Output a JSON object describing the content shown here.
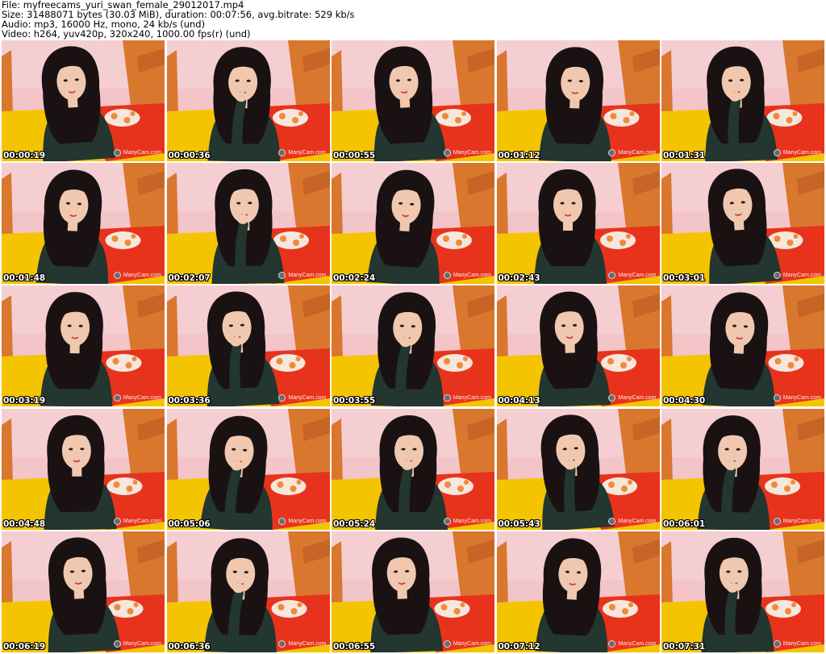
{
  "header": {
    "file_line": "File: myfreecams_yuri_swan_female_29012017.mp4",
    "size_line": "Size: 31488071 bytes (30.03 MiB), duration: 00:07:56, avg.bitrate: 529 kb/s",
    "audio_line": "Audio: mp3, 16000 Hz, mono, 24 kb/s (und)",
    "video_line": "Video: h264, yuv420p, 320x240, 1000.00 fps(r) (und)"
  },
  "watermark": "ManyCam.com",
  "colors": {
    "wall": "#f3c4c8",
    "wood": "#d9772e",
    "yellow_bedding": "#f5c400",
    "red_bedding": "#e8331c",
    "sweater": "#23362f",
    "hair": "#1a1212",
    "skin": "#f0c8b0"
  },
  "thumbnails": [
    {
      "timestamp": "00:00:19"
    },
    {
      "timestamp": "00:00:36"
    },
    {
      "timestamp": "00:00:55"
    },
    {
      "timestamp": "00:01:12"
    },
    {
      "timestamp": "00:01:31"
    },
    {
      "timestamp": "00:01:48"
    },
    {
      "timestamp": "00:02:07"
    },
    {
      "timestamp": "00:02:24"
    },
    {
      "timestamp": "00:02:43"
    },
    {
      "timestamp": "00:03:01"
    },
    {
      "timestamp": "00:03:19"
    },
    {
      "timestamp": "00:03:36"
    },
    {
      "timestamp": "00:03:55"
    },
    {
      "timestamp": "00:04:13"
    },
    {
      "timestamp": "00:04:30"
    },
    {
      "timestamp": "00:04:48"
    },
    {
      "timestamp": "00:05:06"
    },
    {
      "timestamp": "00:05:24"
    },
    {
      "timestamp": "00:05:43"
    },
    {
      "timestamp": "00:06:01"
    },
    {
      "timestamp": "00:06:19"
    },
    {
      "timestamp": "00:06:36"
    },
    {
      "timestamp": "00:06:55"
    },
    {
      "timestamp": "00:07:12"
    },
    {
      "timestamp": "00:07:31"
    }
  ]
}
